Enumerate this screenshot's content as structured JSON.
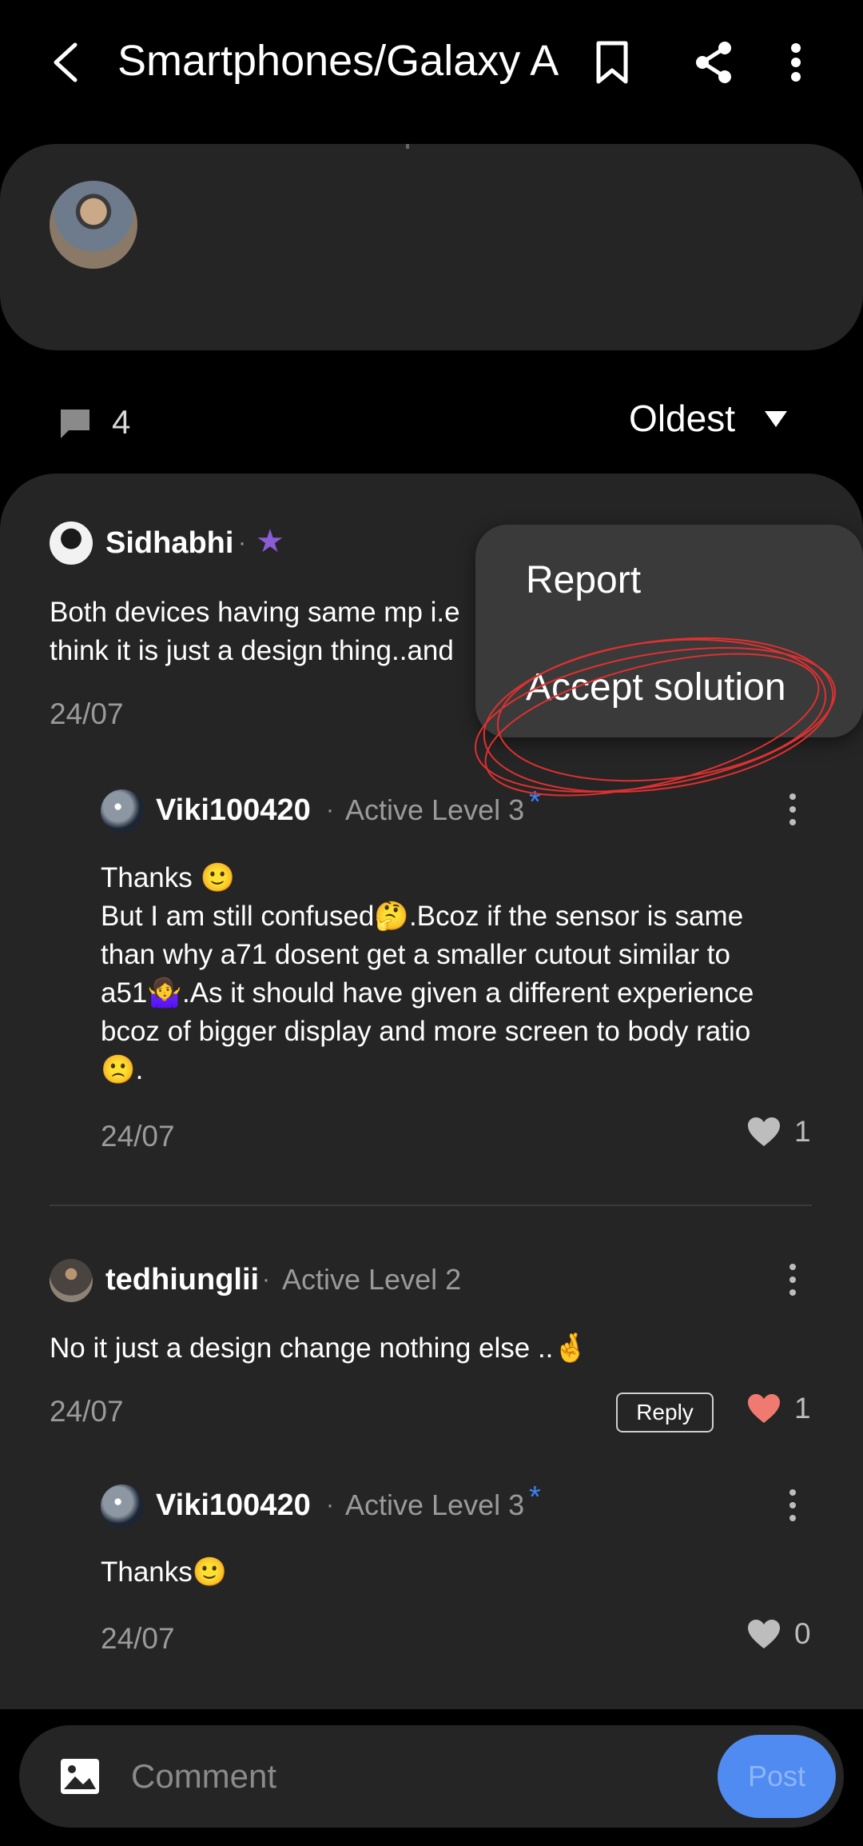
{
  "header": {
    "title": "Smartphones/Galaxy A",
    "back_icon": "back-arrow-icon",
    "bookmark_icon": "bookmark-icon",
    "share_icon": "share-icon",
    "more_icon": "more-vertical-icon"
  },
  "post": {
    "avatar_icon": "user-avatar"
  },
  "comments_meta": {
    "count": "4",
    "sort_label": "Oldest"
  },
  "comments": [
    {
      "user": "Sidhabhi",
      "separator": "·",
      "badge": "★",
      "text_line1": "Both devices having same mp i.e",
      "text_line2": "think it is just a design thing..and",
      "date": "24/07"
    },
    {
      "user": "Viki100420",
      "separator": "·",
      "level": "Active Level 3",
      "level_mark": "*",
      "text_line1": "Thanks 🙂",
      "text_line2": "But I am still confused🤔.Bcoz if the sensor is same",
      "text_line3": "than why a71 dosent get a smaller cutout similar to",
      "text_line4": "a51🤷‍♀️.As it should have given a different experience",
      "text_line5": "bcoz of bigger display and more screen to body ratio",
      "text_line6": "🙁.",
      "date": "24/07",
      "likes": "1"
    },
    {
      "user": "tedhiunglii",
      "separator": "·",
      "level": "Active Level 2",
      "text": "No it just a design change nothing else ..🤞",
      "date": "24/07",
      "reply_label": "Reply",
      "likes": "1"
    },
    {
      "user": "Viki100420",
      "separator": "·",
      "level": "Active Level 3",
      "level_mark": "*",
      "text": "Thanks🙂",
      "date": "24/07",
      "likes": "0"
    }
  ],
  "popup_menu": {
    "items": [
      "Report",
      "Accept solution"
    ]
  },
  "composer": {
    "placeholder": "Comment",
    "post_label": "Post",
    "image_icon": "image-icon"
  },
  "colors": {
    "background": "#000000",
    "card": "#252525",
    "popup": "#3a3a3a",
    "muted_text": "#9a9a9a",
    "accent_blue": "#4f8bf0",
    "liked_heart": "#f07a70",
    "badge_purple": "#8a5cd6",
    "annotation_red": "#e03030"
  }
}
